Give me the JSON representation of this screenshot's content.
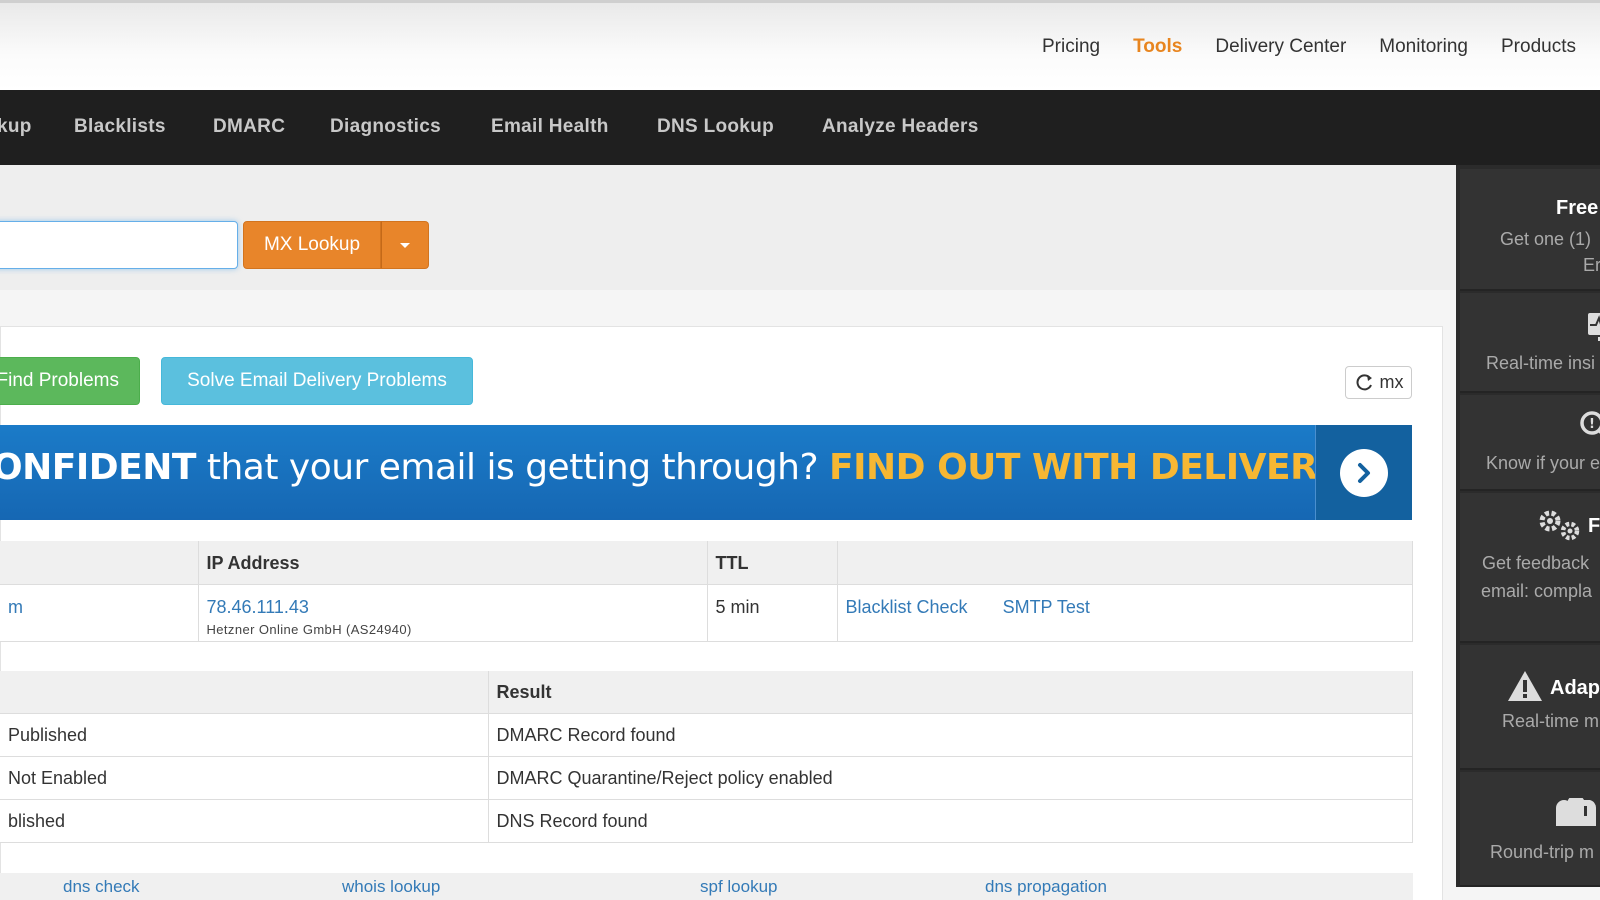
{
  "top_nav": {
    "items": [
      "Pricing",
      "Tools",
      "Delivery Center",
      "Monitoring",
      "Products"
    ],
    "active": "Tools"
  },
  "tools_nav": {
    "items": [
      "kup",
      "Blacklists",
      "DMARC",
      "Diagnostics",
      "Email Health",
      "DNS Lookup",
      "Analyze Headers"
    ]
  },
  "search": {
    "value": "",
    "button_label": "MX Lookup"
  },
  "actions": {
    "find_problems": "Find Problems",
    "solve_delivery": "Solve Email Delivery Problems",
    "refresh_label": "mx"
  },
  "banner": {
    "part1": "ONFIDENT",
    "part2": " that your email is getting through? ",
    "part3": "FIND OUT WITH DELIVERY CENTER"
  },
  "mx_table": {
    "headers": [
      "",
      "IP Address",
      "TTL",
      ""
    ],
    "rows": [
      {
        "host": "m",
        "ip": "78.46.111.43",
        "ip_owner": "Hetzner Online GmbH (AS24940)",
        "ttl": "5 min",
        "link1": "Blacklist Check",
        "link2": "SMTP Test"
      }
    ]
  },
  "dmarc_table": {
    "headers": [
      "",
      "Result"
    ],
    "rows": [
      {
        "test": "Published",
        "result": "DMARC Record found"
      },
      {
        "test": "Not Enabled",
        "result": "DMARC Quarantine/Reject policy enabled"
      },
      {
        "test": "blished",
        "result": "DNS Record found"
      }
    ]
  },
  "footer_links": [
    "dns check",
    "whois lookup",
    "spf lookup",
    "dns propagation"
  ],
  "sidebar": {
    "cards": [
      {
        "title": "Free",
        "line1": "Get one (1)",
        "line2": "Er"
      },
      {
        "icon": "monitor-pulse-icon",
        "text": "Real-time insi"
      },
      {
        "icon": "search-warning-icon",
        "text": "Know if your e"
      },
      {
        "icon": "gears-icon",
        "title": "F",
        "line1": "Get feedback",
        "line2": "email: compla"
      },
      {
        "icon": "warning-icon",
        "title": "Adap",
        "text": "Real-time m"
      },
      {
        "icon": "mailbox-icon",
        "text": "Round-trip m"
      }
    ]
  },
  "colors": {
    "accent_orange": "#e8852a",
    "nav_dark": "#1f1f1f",
    "link_blue": "#337ab7",
    "btn_green": "#5cb85c",
    "btn_blue": "#5bc0de",
    "banner_blue": "#1b7bc8",
    "banner_yellow": "#f7b733"
  }
}
